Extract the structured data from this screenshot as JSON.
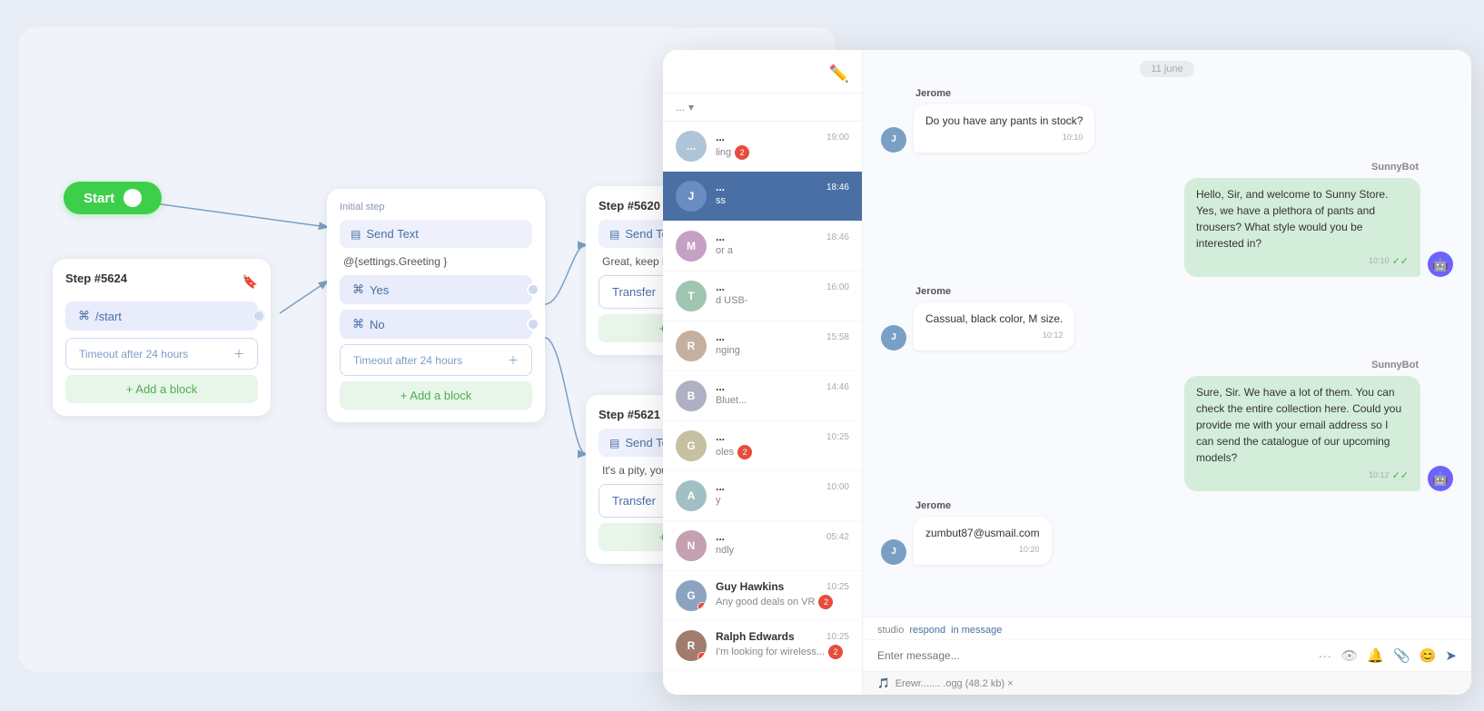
{
  "flow": {
    "start_label": "Start",
    "step_5624": {
      "number": "Step #5624",
      "command": "/start",
      "timeout": "Timeout after 24 hours",
      "add_block": "+ Add a block"
    },
    "initial_step": {
      "title": "Initial step",
      "send_text_label": "Send Text",
      "greeting": "@{settings.Greeting }",
      "yes_label": "Yes",
      "no_label": "No",
      "timeout": "Timeout after 24 hours",
      "add_block": "+ Add a block"
    },
    "step_5620": {
      "number": "Step #5620",
      "send_text_label": "Send Text",
      "content": "Great, keep it up",
      "transfer_label": "Transfer",
      "add_block": "+ Add a block"
    },
    "step_5621": {
      "number": "Step #5621",
      "send_text_label": "Send Text",
      "content": "It's a pity, you will succeed",
      "transfer_label": "Transfer",
      "add_block": "+ Add a block"
    }
  },
  "chat": {
    "date_divider": "11 june",
    "sidebar": {
      "items": [
        {
          "name": "...",
          "time": "19:00",
          "preview": "ling",
          "badge": "2",
          "active": false
        },
        {
          "name": "...",
          "time": "18:46",
          "preview": "ss",
          "badge": "",
          "active": true
        },
        {
          "name": "...",
          "time": "18:46",
          "preview": "or a",
          "badge": "",
          "active": false
        },
        {
          "name": "...",
          "time": "16:00",
          "preview": "d USB-",
          "badge": "",
          "active": false
        },
        {
          "name": "...",
          "time": "15:58",
          "preview": "nging",
          "badge": "",
          "active": false
        },
        {
          "name": "...",
          "time": "14:46",
          "preview": "Bluet...",
          "badge": "",
          "active": false
        },
        {
          "name": "...",
          "time": "10:25",
          "preview": "oles",
          "badge": "2",
          "active": false
        },
        {
          "name": "...",
          "time": "10:00",
          "preview": "y",
          "badge": "",
          "active": false
        },
        {
          "name": "...",
          "time": "05:42",
          "preview": "ndly",
          "badge": "",
          "active": false
        },
        {
          "name": "Guy Hawkins",
          "time": "10:25",
          "preview": "Any good deals on VR",
          "badge": "2",
          "active": false
        },
        {
          "name": "Ralph Edwards",
          "time": "10:25",
          "preview": "I'm looking for wireless...",
          "badge": "2",
          "active": false
        }
      ]
    },
    "messages": [
      {
        "type": "user",
        "sender": "Jerome",
        "text": "Do you have any pants in stock?",
        "time": "10:10"
      },
      {
        "type": "bot",
        "sender": "SunnyBot",
        "text": "Hello, Sir, and welcome to Sunny Store. Yes, we have a plethora of pants and trousers? What style would you be interested in?",
        "time": "10:10",
        "ticks": true
      },
      {
        "type": "user",
        "sender": "Jerome",
        "text": "Cassual, black color, M size.",
        "time": "10:12"
      },
      {
        "type": "bot",
        "sender": "SunnyBot",
        "text": "Sure, Sir. We have a lot of them. You can check the entire collection here. Could you provide me with your email address so I can send the catalogue of our upcoming models?",
        "time": "10:12",
        "ticks": true
      },
      {
        "type": "user",
        "sender": "Jerome",
        "text": "zumbut87@usmail.com",
        "time": "10:20"
      }
    ],
    "footer": {
      "studio_label": "studio",
      "respond_label": "respond",
      "in_label": "in message",
      "placeholder": "Enter message...",
      "attachment_label": "Erewr....... .ogg  (48.2 kb) ×"
    }
  }
}
